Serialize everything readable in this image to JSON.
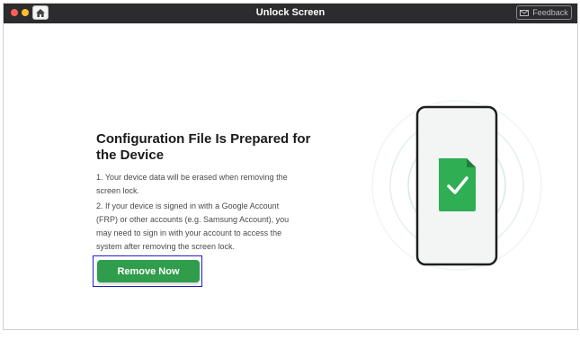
{
  "window": {
    "title": "Unlock Screen",
    "feedback_label": "Feedback"
  },
  "main": {
    "heading": "Configuration File Is Prepared for the Device",
    "steps": [
      "1. Your device data will be erased when removing the screen lock.",
      "2. If your device is signed in with a Google Account (FRP) or other accounts (e.g. Samsung Account), you may need to sign in with your account to access the system after removing the screen lock."
    ],
    "remove_button_label": "Remove Now"
  },
  "icons": {
    "home": "home-icon",
    "feedback": "mail-icon",
    "file": "config-file-check-icon"
  },
  "colors": {
    "titlebar": "#2c2c2e",
    "accent_green": "#2f9d4b",
    "focus_outline": "#2020c0"
  }
}
